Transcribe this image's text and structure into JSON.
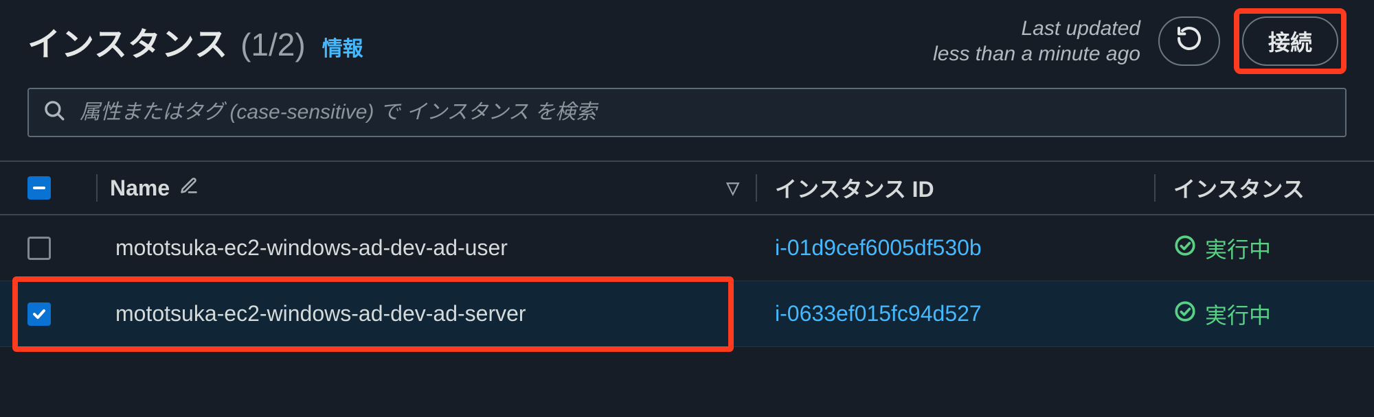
{
  "header": {
    "title": "インスタンス",
    "count": "(1/2)",
    "info_label": "情報",
    "last_updated_line1": "Last updated",
    "last_updated_line2": "less than a minute ago",
    "connect_label": "接続"
  },
  "search": {
    "placeholder": "属性またはタグ (case-sensitive) で インスタンス を検索"
  },
  "columns": {
    "name": "Name",
    "instance_id": "インスタンス ID",
    "instance_state": "インスタンス"
  },
  "rows": [
    {
      "checked": false,
      "name": "mototsuka-ec2-windows-ad-dev-ad-user",
      "instance_id": "i-01d9cef6005df530b",
      "state": "実行中"
    },
    {
      "checked": true,
      "name": "mototsuka-ec2-windows-ad-dev-ad-server",
      "instance_id": "i-0633ef015fc94d527",
      "state": "実行中"
    }
  ]
}
